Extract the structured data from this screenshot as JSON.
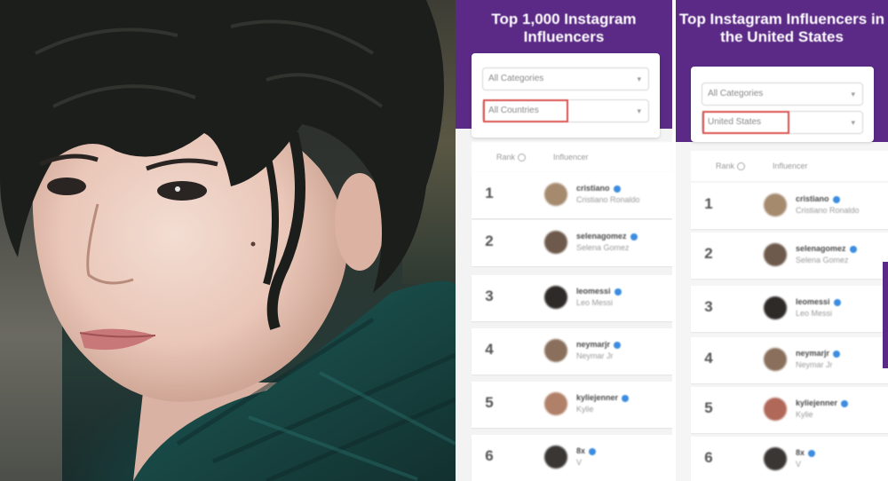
{
  "left_panel": {
    "title": "Top 1,000 Instagram Influencers",
    "filters": {
      "category": "All Categories",
      "country": "All Countries"
    },
    "columns": {
      "rank": "Rank",
      "influencer": "Influencer"
    },
    "rows": [
      {
        "rank": "1",
        "handle": "cristiano",
        "name": "Cristiano Ronaldo"
      },
      {
        "rank": "2",
        "handle": "selenagomez",
        "name": "Selena Gomez"
      },
      {
        "rank": "3",
        "handle": "leomessi",
        "name": "Leo Messi"
      },
      {
        "rank": "4",
        "handle": "neymarjr",
        "name": "Neymar Jr"
      },
      {
        "rank": "5",
        "handle": "kyliejenner",
        "name": "Kylie"
      },
      {
        "rank": "6",
        "handle": "8x",
        "name": "V"
      }
    ]
  },
  "right_panel": {
    "title": "Top Instagram Influencers in the United States",
    "filters": {
      "category": "All Categories",
      "country": "United States"
    },
    "columns": {
      "rank": "Rank",
      "influencer": "Influencer"
    },
    "rows": [
      {
        "rank": "1",
        "handle": "cristiano",
        "name": "Cristiano Ronaldo"
      },
      {
        "rank": "2",
        "handle": "selenagomez",
        "name": "Selena Gomez"
      },
      {
        "rank": "3",
        "handle": "leomessi",
        "name": "Leo Messi"
      },
      {
        "rank": "4",
        "handle": "neymarjr",
        "name": "Neymar Jr"
      },
      {
        "rank": "5",
        "handle": "kyliejenner",
        "name": "Kylie"
      },
      {
        "rank": "6",
        "handle": "8x",
        "name": "V"
      }
    ]
  },
  "colors": {
    "brand_purple": "#5b2a86",
    "highlight_red": "#d9534f",
    "verified_blue": "#3c8de0"
  }
}
